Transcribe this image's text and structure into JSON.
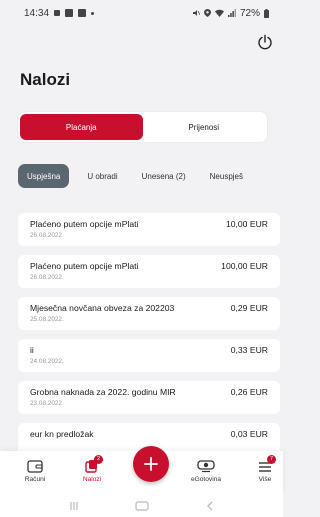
{
  "status_bar": {
    "time": "14:34",
    "battery": "72%"
  },
  "header": {
    "title": "Nalozi"
  },
  "segments": [
    {
      "label": "Plaćanja",
      "active": true
    },
    {
      "label": "Prijenosi",
      "active": false
    }
  ],
  "filter_tabs": [
    {
      "label": "Uspješna",
      "active": true
    },
    {
      "label": "U obradi",
      "active": false
    },
    {
      "label": "Unesena (2)",
      "active": false
    },
    {
      "label": "Neuspješ",
      "active": false
    }
  ],
  "orders": [
    {
      "title": "Plaćeno putem opcije mPlati",
      "date": "26.08.2022.",
      "amount": "10,00 EUR"
    },
    {
      "title": "Plaćeno putem opcije mPlati",
      "date": "26.08.2022.",
      "amount": "100,00 EUR"
    },
    {
      "title": "Mjesečna novčana obveza za 202203",
      "date": "25.08.2022.",
      "amount": "0,29 EUR"
    },
    {
      "title": "ii",
      "date": "24.08.2022.",
      "amount": "0,33 EUR"
    },
    {
      "title": "Grobna naknada za 2022. godinu  MIR",
      "date": "23.08.2022.",
      "amount": "0,26 EUR"
    },
    {
      "title": "eur kn predložak",
      "date": "",
      "amount": "0,03 EUR"
    }
  ],
  "bottom_nav": [
    {
      "label": "Računi",
      "icon": "wallet-icon",
      "active": false,
      "badge": ""
    },
    {
      "label": "Nalozi",
      "icon": "orders-icon",
      "active": true,
      "badge": "2"
    },
    {
      "label": "eGotovina",
      "icon": "cash-icon",
      "active": false,
      "badge": ""
    },
    {
      "label": "Više",
      "icon": "menu-icon",
      "active": false,
      "badge": "7"
    }
  ],
  "colors": {
    "accent": "#c8102e",
    "tab_active": "#5a6670",
    "background": "#f2f2f4"
  }
}
